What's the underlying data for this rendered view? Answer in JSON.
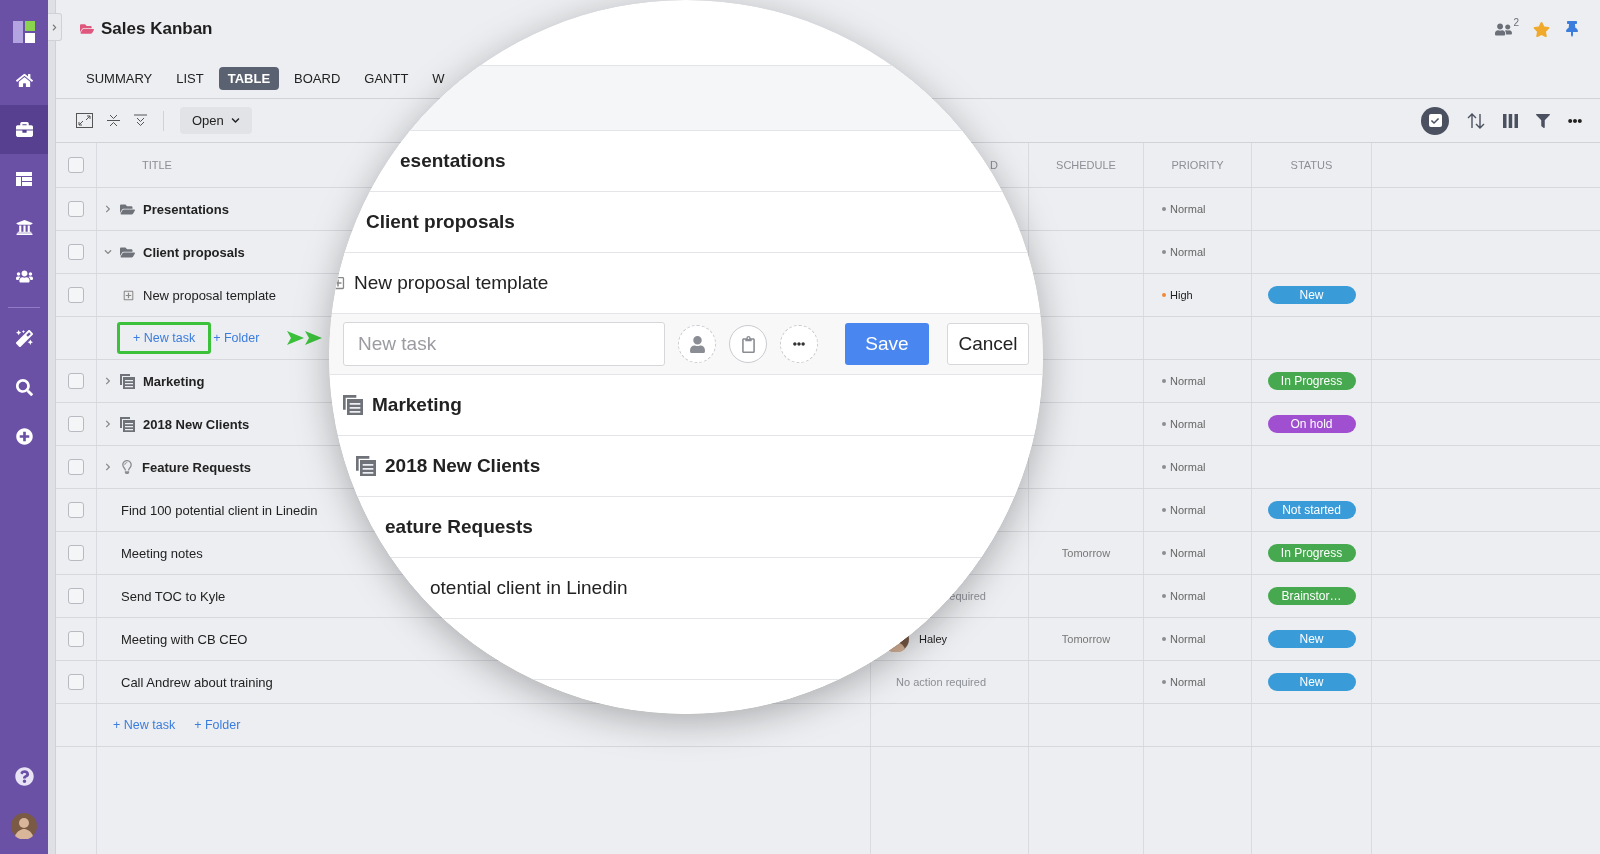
{
  "sidebar": {
    "items": [
      {
        "kind": "home",
        "selected": false
      },
      {
        "kind": "projects",
        "selected": true
      },
      {
        "kind": "boards",
        "selected": false
      },
      {
        "kind": "bank",
        "selected": false
      },
      {
        "kind": "team",
        "selected": false
      }
    ],
    "tools": [
      {
        "kind": "magic",
        "selected": false
      },
      {
        "kind": "search",
        "selected": false
      },
      {
        "kind": "add",
        "selected": false
      }
    ]
  },
  "header": {
    "title": "Sales Kanban",
    "watchers": "2"
  },
  "tabs": [
    {
      "label": "SUMMARY",
      "selected": false
    },
    {
      "label": "LIST",
      "selected": false
    },
    {
      "label": "TABLE",
      "selected": true
    },
    {
      "label": "BOARD",
      "selected": false
    },
    {
      "label": "GANTT",
      "selected": false
    },
    {
      "label": "W",
      "selected": false
    }
  ],
  "toolbar": {
    "filter": "Open"
  },
  "table": {
    "select_all_checked": false,
    "columns": [
      "TITLE",
      "D",
      "SCHEDULE",
      "PRIORITY",
      "STATUS"
    ],
    "rows": [
      {
        "kind": "folder",
        "title": "Presentations",
        "expanded": false,
        "checked": false,
        "priority": {
          "label": "Normal",
          "color": "#8a8d93"
        }
      },
      {
        "kind": "folder",
        "title": "Client proposals",
        "expanded": true,
        "checked": false,
        "priority": {
          "label": "Normal",
          "color": "#8a8d93"
        }
      },
      {
        "kind": "subtask",
        "title": "New proposal template",
        "checked": false,
        "priority": {
          "label": "High",
          "color": "#f0883a"
        },
        "status": {
          "label": "New",
          "color": "#3a9bd9"
        }
      },
      {
        "kind": "add",
        "links": [
          {
            "label": "+ New task",
            "highlighted": true
          },
          {
            "label": "+ Folder",
            "highlighted": false
          }
        ]
      },
      {
        "kind": "project",
        "title": "Marketing",
        "expanded": false,
        "checked": false,
        "priority": {
          "label": "Normal",
          "color": "#8a8d93"
        },
        "status": {
          "label": "In Progress",
          "color": "#47a94f"
        }
      },
      {
        "kind": "project",
        "title": "2018 New Clients",
        "expanded": false,
        "checked": false,
        "priority": {
          "label": "Normal",
          "color": "#8a8d93"
        },
        "status": {
          "label": "On hold",
          "color": "#a04fd0"
        }
      },
      {
        "kind": "idea",
        "title": "Feature Requests",
        "expanded": false,
        "checked": false,
        "priority": {
          "label": "Normal",
          "color": "#8a8d93"
        }
      },
      {
        "kind": "task",
        "title": "Find 100 potential client in Linedin",
        "checked": false,
        "priority": {
          "label": "Normal",
          "color": "#8a8d93"
        },
        "status": {
          "label": "Not started",
          "color": "#3a9bd9"
        }
      },
      {
        "kind": "task",
        "title": "Meeting notes",
        "checked": false,
        "schedule": "Tomorrow",
        "priority": {
          "label": "Normal",
          "color": "#8a8d93"
        },
        "status": {
          "label": "In Progress",
          "color": "#47a94f"
        }
      },
      {
        "kind": "task",
        "title": "Send TOC to Kyle",
        "checked": false,
        "assigned": {
          "kind": "note",
          "text": "equired"
        },
        "priority": {
          "label": "Normal",
          "color": "#8a8d93"
        },
        "status": {
          "label": "Brainstor…",
          "color": "#47a94f"
        }
      },
      {
        "kind": "task",
        "title": "Meeting with CB CEO",
        "checked": false,
        "assigned": {
          "kind": "person",
          "name": "Haley"
        },
        "schedule": "Tomorrow",
        "priority": {
          "label": "Normal",
          "color": "#8a8d93"
        },
        "status": {
          "label": "New",
          "color": "#3a9bd9"
        }
      },
      {
        "kind": "task",
        "title": "Call Andrew about training",
        "checked": false,
        "assigned": {
          "kind": "note",
          "text": "No action required"
        },
        "priority": {
          "label": "Normal",
          "color": "#8a8d93"
        },
        "status": {
          "label": "New",
          "color": "#3a9bd9"
        }
      },
      {
        "kind": "add",
        "links": [
          {
            "label": "+ New task",
            "highlighted": false
          },
          {
            "label": "+ Folder",
            "highlighted": false
          }
        ]
      }
    ]
  },
  "magnifier": {
    "rows": [
      {
        "kind": "folder",
        "title": "esentations"
      },
      {
        "kind": "folder",
        "title": "Client proposals"
      },
      {
        "kind": "subtask",
        "title": "New proposal template"
      },
      {
        "kind": "editor",
        "placeholder": "New task",
        "save": "Save",
        "cancel": "Cancel"
      },
      {
        "kind": "project",
        "title": "Marketing"
      },
      {
        "kind": "project",
        "title": "2018 New Clients"
      },
      {
        "kind": "folder",
        "title": "eature Requests"
      },
      {
        "kind": "task",
        "title": "otential client in Linedin"
      }
    ]
  }
}
